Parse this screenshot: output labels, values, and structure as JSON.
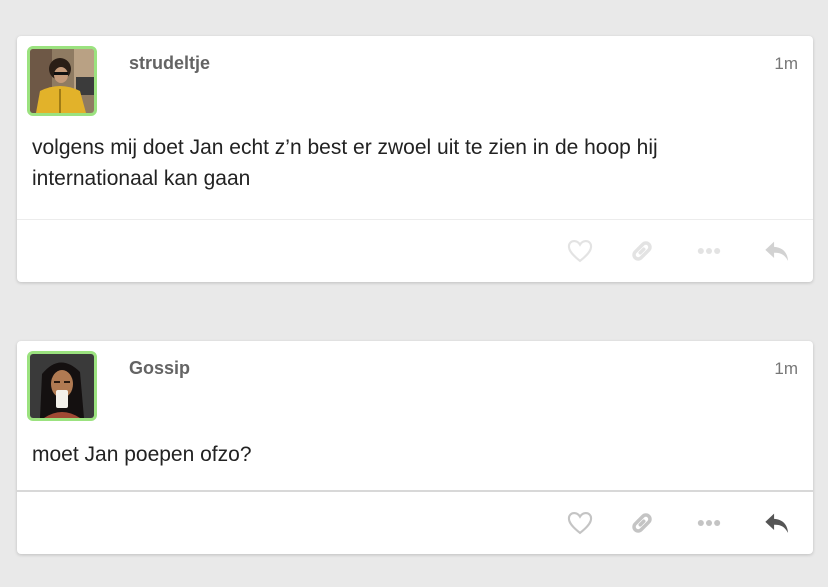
{
  "posts": [
    {
      "username": "strudeltje",
      "timestamp": "1m",
      "body": "volgens mij doet Jan echt z’n best er zwoel uit te zien in de hoop hij internationaal kan gaan",
      "avatar_border_color": "#9be27f",
      "actions": [
        "heart-icon",
        "link-icon",
        "more-icon",
        "reply-icon"
      ]
    },
    {
      "username": "Gossip",
      "timestamp": "1m",
      "body": "moet Jan poepen ofzo?",
      "avatar_border_color": "#9be27f",
      "actions": [
        "heart-icon",
        "link-icon",
        "more-icon",
        "reply-icon"
      ]
    }
  ]
}
